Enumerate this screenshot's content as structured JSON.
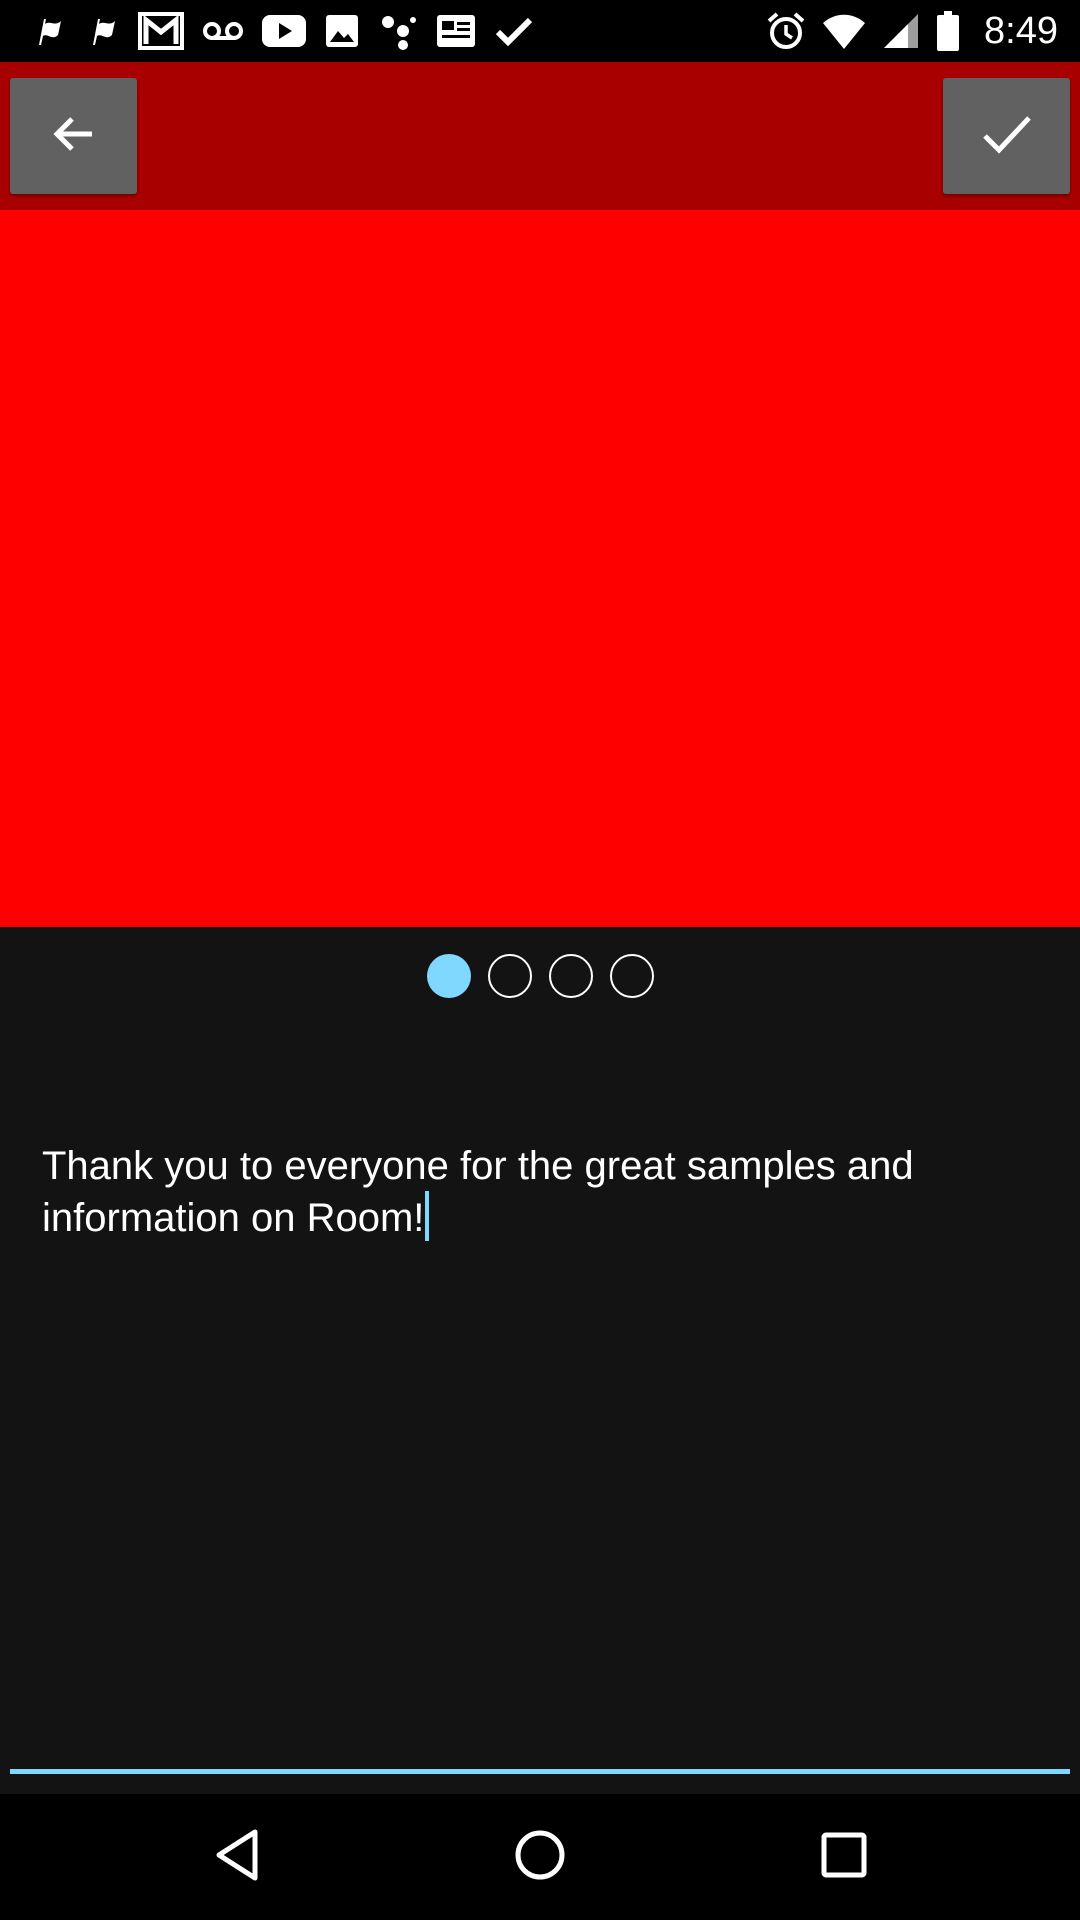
{
  "status_bar": {
    "time": "8:49",
    "left_icons": [
      "flag-notification-icon",
      "flag-notification-icon",
      "gmail-icon",
      "voicemail-icon",
      "youtube-icon",
      "photos-icon",
      "dots-app-icon",
      "news-icon",
      "check-notification-icon"
    ],
    "right_icons": [
      "alarm-icon",
      "wifi-icon",
      "cell-signal-icon",
      "battery-icon"
    ]
  },
  "action_bar": {
    "back_icon": "arrow-left-icon",
    "confirm_icon": "checkmark-icon",
    "background_color": "#a80000"
  },
  "preview": {
    "color": "#ff0000"
  },
  "page_indicator": {
    "pages": 4,
    "active_index": 0,
    "active_color": "#80d8ff"
  },
  "message": {
    "text": "Thank you to everyone for the great samples and information on Room!",
    "cursor_color": "#80d8ff",
    "underline_color": "#80d8ff"
  },
  "nav_bar": {
    "icons": [
      "nav-back-icon",
      "nav-home-icon",
      "nav-recents-icon"
    ]
  }
}
